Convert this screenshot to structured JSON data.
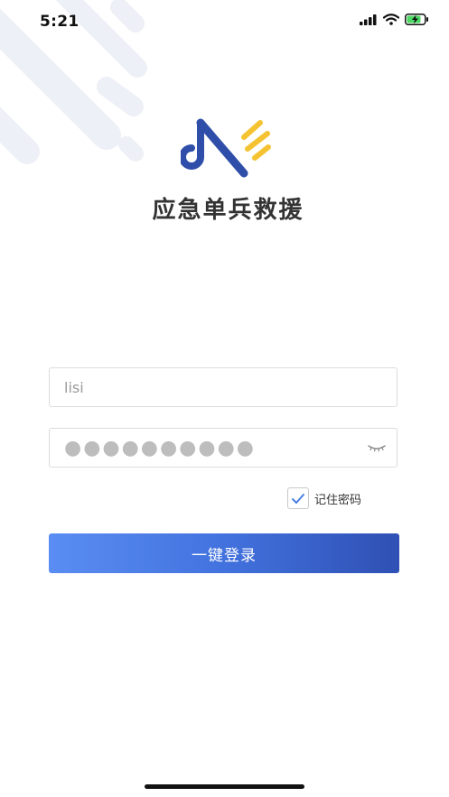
{
  "status_bar": {
    "time": "5:21"
  },
  "brand": {
    "name": "应急单兵救援",
    "primary_color": "#2f4ea9",
    "accent_color": "#f5c332"
  },
  "login_form": {
    "username_value": "lisi",
    "password_masked": "●●●●●●●●●●",
    "remember_label": "记住密码",
    "remember_checked": true,
    "login_label": "一键登录"
  },
  "icons": {
    "signal": "cellular-signal-icon",
    "wifi": "wifi-icon",
    "battery": "battery-charging-icon",
    "eye": "eye-closed-icon",
    "check": "check-icon"
  }
}
